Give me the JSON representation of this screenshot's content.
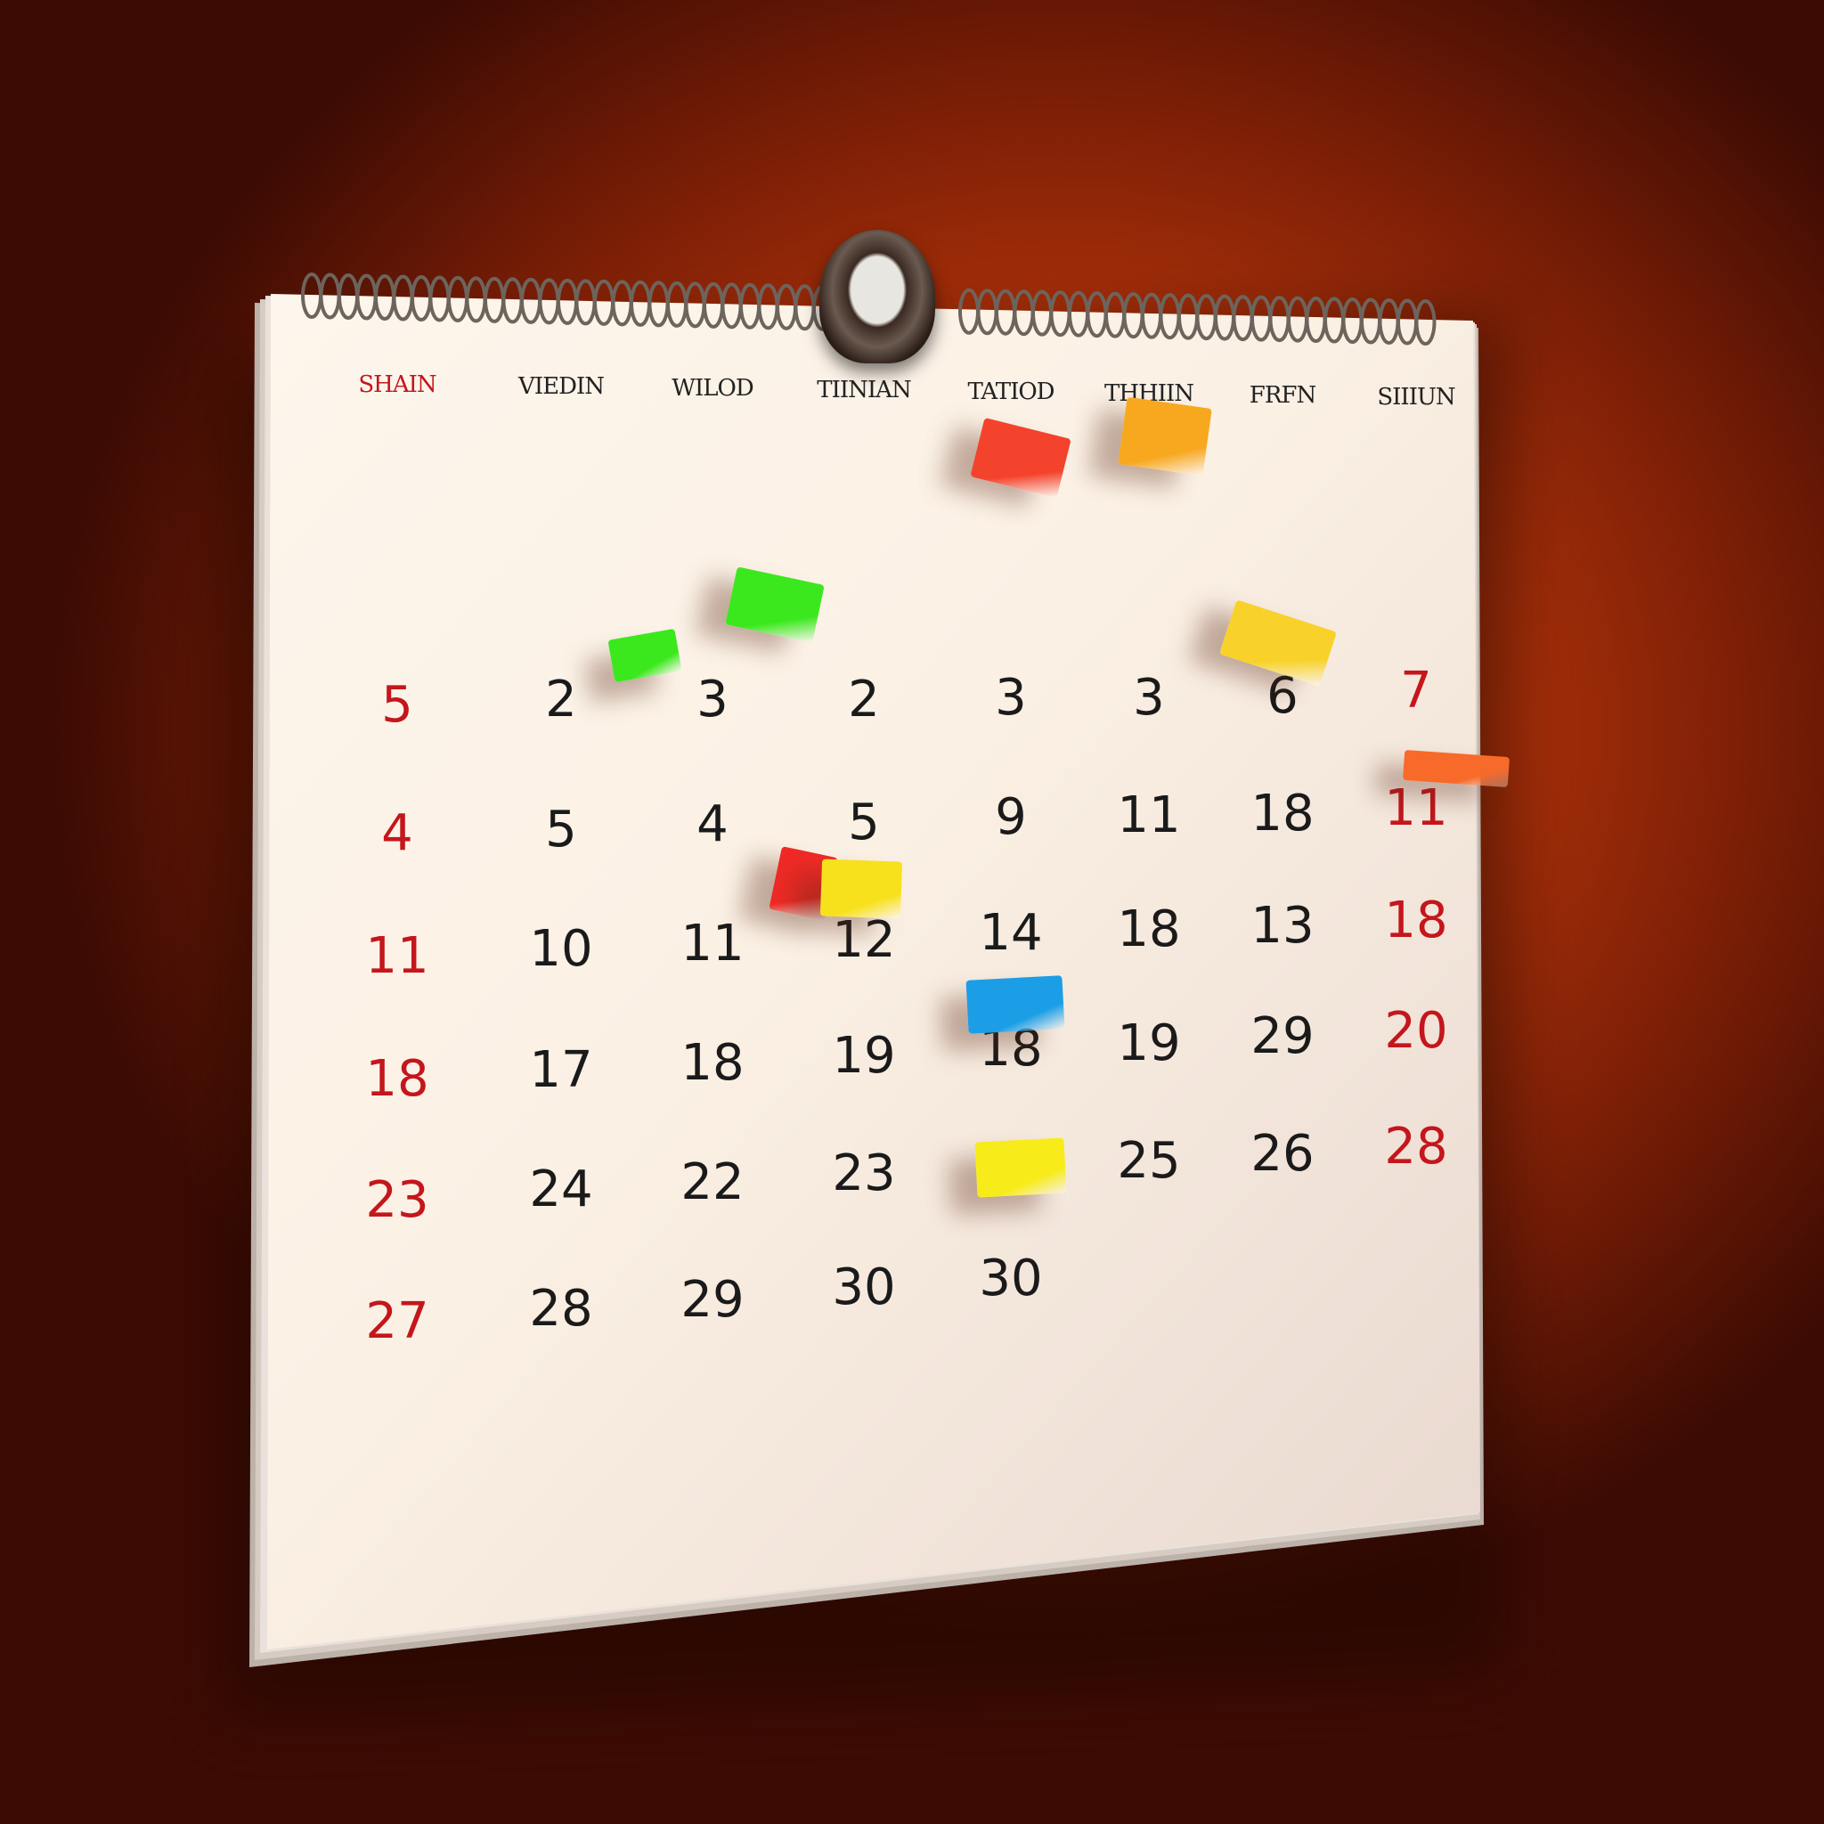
{
  "calendar": {
    "weekday_headers": [
      {
        "text": "SHAIN",
        "color": "#c4161c"
      },
      {
        "text": "VIEDIN",
        "color": "#222222"
      },
      {
        "text": "WILOD",
        "color": "#222222"
      },
      {
        "text": "TIINIAN",
        "color": "#222222"
      },
      {
        "text": "TATIOD",
        "color": "#222222"
      },
      {
        "text": "THHIIN",
        "color": "#222222"
      },
      {
        "text": "FRFN",
        "color": "#222222"
      },
      {
        "text": "SIIIUN",
        "color": "#222222"
      }
    ],
    "rows": [
      [
        "5",
        "2",
        "3",
        "2",
        "3",
        "3",
        "6",
        "7"
      ],
      [
        "4",
        "5",
        "4",
        "5",
        "9",
        "11",
        "18",
        "11"
      ],
      [
        "11",
        "10",
        "11",
        "12",
        "14",
        "18",
        "13",
        "18"
      ],
      [
        "18",
        "17",
        "18",
        "19",
        "18",
        "19",
        "29",
        "20"
      ],
      [
        "23",
        "24",
        "22",
        "23",
        "",
        "25",
        "26",
        "28"
      ],
      [
        "27",
        "28",
        "29",
        "30",
        "30",
        "",
        "",
        ""
      ]
    ],
    "red_color": "#c4161c",
    "black_color": "#1a1a1a"
  },
  "sticky_notes": [
    {
      "color": "#f4432c"
    },
    {
      "color": "#f7a81f"
    },
    {
      "color": "#3be81d"
    },
    {
      "color": "#3be81d"
    },
    {
      "color": "#f8d22a"
    },
    {
      "color": "#f86a2a"
    },
    {
      "color": "#ef2a26"
    },
    {
      "color": "#f7e11c"
    },
    {
      "color": "#1c9ee6"
    },
    {
      "color": "#f7ec1a"
    }
  ]
}
